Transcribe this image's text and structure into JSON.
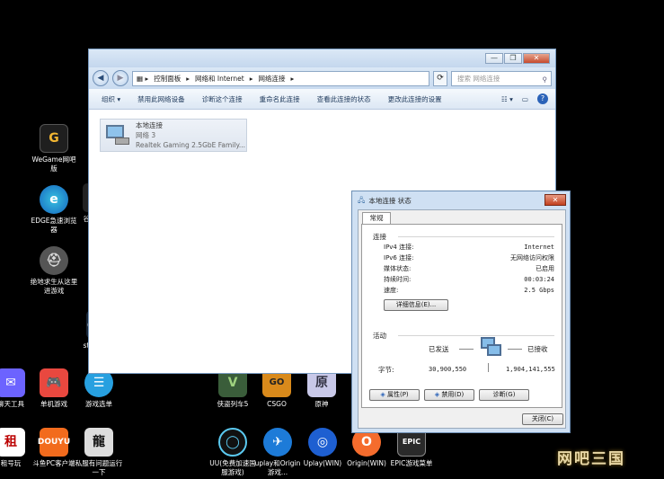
{
  "desktop": {
    "icons": [
      {
        "label": "WeGame网吧版"
      },
      {
        "label": "EDGE急速浏览器"
      },
      {
        "label": "绝地求生从这里进游戏"
      },
      {
        "label": "聊天工具"
      },
      {
        "label": "单机游戏"
      },
      {
        "label": "游戏选单"
      },
      {
        "label": "侠盗列车5"
      },
      {
        "label": "CSGO"
      },
      {
        "label": "原神"
      },
      {
        "label": "租号玩"
      },
      {
        "label": "斗鱼PC客户端"
      },
      {
        "label": "私服有问题运行一下"
      },
      {
        "label": "UU(免费加速国服游戏)"
      },
      {
        "label": "uplay和Origin游戏..."
      },
      {
        "label": "Uplay(WIN)"
      },
      {
        "label": "Origin(WIN)"
      },
      {
        "label": "EPIC游戏菜单"
      }
    ],
    "partial_labels": {
      "steam": "ste",
      "gu": "谷"
    },
    "watermark": "网吧三国"
  },
  "explorer": {
    "breadcrumb": [
      "控制面板",
      "网络和 Internet",
      "网络连接"
    ],
    "search_placeholder": "搜索 网络连接",
    "commands": [
      "组织 ▾",
      "禁用此网络设备",
      "诊断这个连接",
      "重命名此连接",
      "查看此连接的状态",
      "更改此连接的设置"
    ],
    "connection": {
      "name": "本地连接",
      "network": "网络 3",
      "adapter": "Realtek Gaming 2.5GbE Family..."
    }
  },
  "status_dialog": {
    "title": "本地连接 状态",
    "tab": "常规",
    "connection_section": "连接",
    "rows": [
      {
        "label": "IPv4 连接:",
        "value": "Internet"
      },
      {
        "label": "IPv6 连接:",
        "value": "无网络访问权限"
      },
      {
        "label": "媒体状态:",
        "value": "已启用"
      },
      {
        "label": "持续时间:",
        "value": "00:03:24"
      },
      {
        "label": "速度:",
        "value": "2.5 Gbps"
      }
    ],
    "details_button": "详细信息(E)...",
    "activity_section": "活动",
    "sent_label": "已发送",
    "received_label": "已接收",
    "bytes_label": "字节:",
    "bytes_sent": "30,900,550",
    "bytes_received": "1,904,141,555",
    "properties_button": "属性(P)",
    "disable_button": "禁用(D)",
    "diagnose_button": "诊断(G)",
    "close_button": "关闭(C)"
  }
}
